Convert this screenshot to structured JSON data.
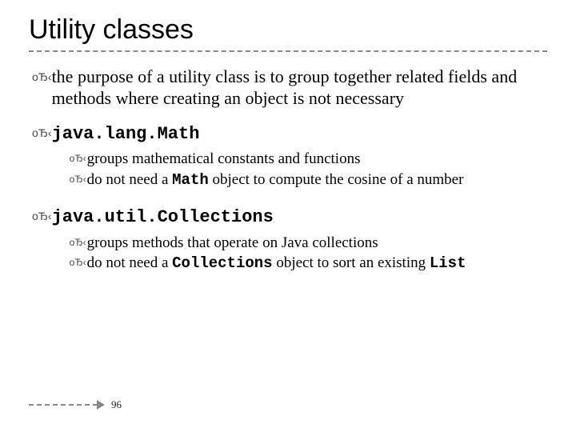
{
  "title": "Utility classes",
  "blocks": [
    {
      "runs": [
        {
          "t": "the purpose of a utility class is to group together related fields and methods where creating an object is not necessary"
        }
      ],
      "sub": []
    },
    {
      "runs": [
        {
          "t": "java.lang.Math",
          "cls": "code"
        }
      ],
      "sub": [
        {
          "runs": [
            {
              "t": "groups mathematical constants and functions"
            }
          ]
        },
        {
          "runs": [
            {
              "t": "do not need a "
            },
            {
              "t": "Math",
              "cls": "code"
            },
            {
              "t": " object to compute the cosine of a number"
            }
          ]
        }
      ]
    },
    {
      "runs": [
        {
          "t": "java.util.Collections",
          "cls": "code"
        }
      ],
      "sub": [
        {
          "runs": [
            {
              "t": "groups methods that operate on Java collections"
            }
          ]
        },
        {
          "runs": [
            {
              "t": "do not need a "
            },
            {
              "t": "Collections",
              "cls": "code"
            },
            {
              "t": " object to sort an existing "
            },
            {
              "t": "List",
              "cls": "code"
            }
          ]
        }
      ]
    }
  ],
  "bullet_glyph": "оЂ‹",
  "page_number": "96"
}
